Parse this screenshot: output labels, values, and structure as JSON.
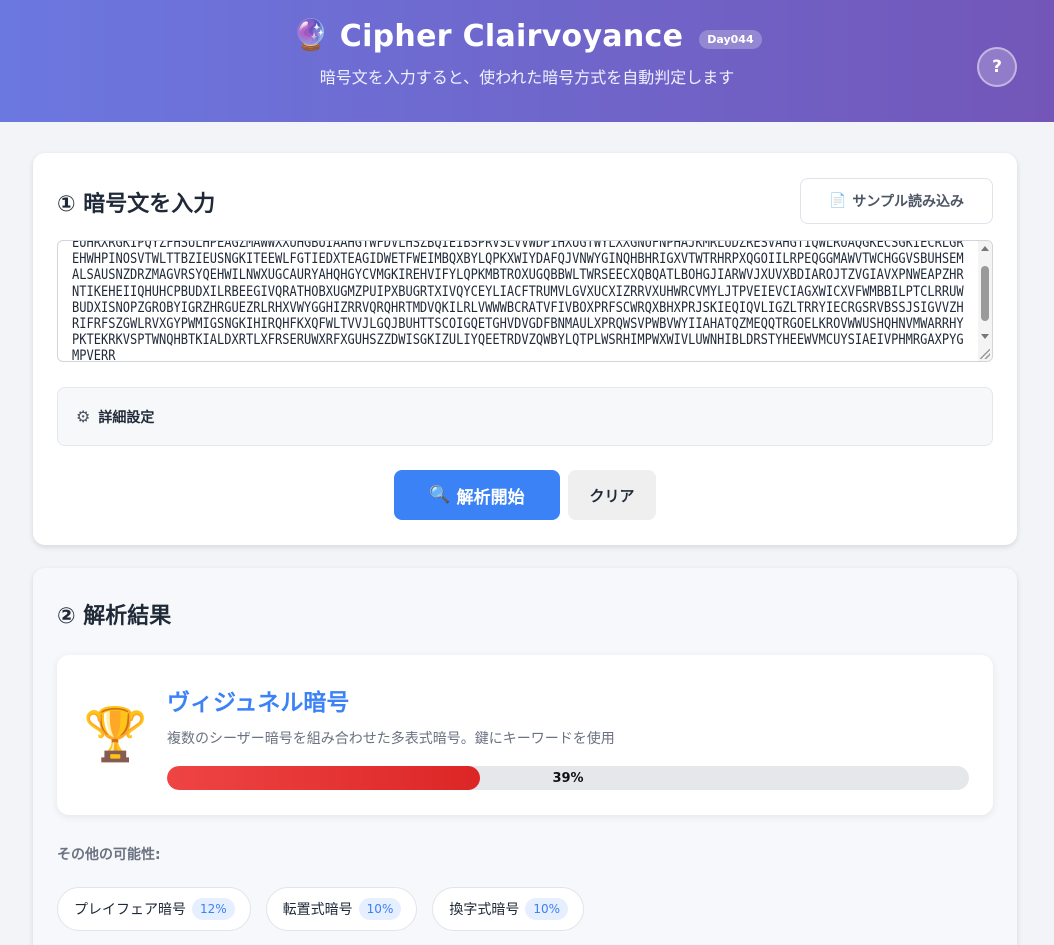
{
  "header": {
    "logo_icon": "crystal-ball",
    "title": "Cipher Clairvoyance",
    "day_badge": "Day044",
    "subtitle": "暗号文を入力すると、使われた暗号方式を自動判定します",
    "help_label": "?"
  },
  "input_section": {
    "title": "① 暗号文を入力",
    "sample_button_label": "サンプル読み込み",
    "cipher_text": "EUHRXRGKIPQYZFHSULHPEAGZMAWWXXUHGBUIAAHGTWFDVLHSZBQIEIBSPRVSLVVWDPIHXUGTWYLXXGNUFNPHAJKMRLUDZRESVAHGTIQWLRUAQGKECSGKIECRLGREHWHPINOSVTWLTTBZIEUSNGKITEEWLFGTIEDXTEAGIDWETFWEIMBQXBYLQPKXWIYDAFQJVNWYGINQHBHRIGXVTWTRHRPXQGOIILRPEQGGMAWVTWCHGGVSBUHSEMALSAUSNZDRZMAGVRSYQEHWILNWXUGCAURYAHQHGYCVMGKIREHVIFYLQPKMBTROXUGQBBWLTWRSEECXQBQATLBOHGJIARWVJXUVXBDIAROJTZVGIAVXPNWEAPZHRNTIKEHEIIQHUHCPBUDXILRBEEGIVQRATHOBXUGMZPUIPXBUGRTXIVQYCEYLIACFTRUMVLGVXUCXIZRRVXUHWRCVMYLJTPVEIEVCIAGXWICXVFWMBBILPTCLRRUWBUDXISNOPZGROBYIGRZHRGUEZRLRHXVWYGGHIZRRVQRQHRTMDVQKILRLVWWWBCRATVFIVBOXPRFSCWRQXBHXPRJSKIEQIQVLIGZLTRRYIECRGSRVBSSJSIGVVZHRIFRFSZGWLRVXGYPWMIGSNGKIHIRQHFKXQFWLTVVJLGQJBUHTTSCOIGQETGHVDVGDFBNMAULXPRQWSVPWBVWYIIAHATQZMEQQTRGOELKROVWWUSHQHNVMWARRHYPKTEKRKVSPTWNQHBTKIALDXRTLXFRSERUWXRFXGUHSZZDWISGKIZULIYQEETRDVZQWBYLQTPLWSRHIMPWXWIVLUWNHIBLDRSTYHEEWVMCUYSIAEIVPHMRGAXPYGMPVERR",
    "advanced_settings_label": "詳細設定",
    "analyze_button_label": "解析開始",
    "clear_button_label": "クリア"
  },
  "results_section": {
    "title": "② 解析結果",
    "top_result": {
      "icon": "trophy",
      "name": "ヴィジュネル暗号",
      "description": "複数のシーザー暗号を組み合わせた多表式暗号。鍵にキーワードを使用",
      "confidence_label": "39%",
      "confidence_value": 0.39,
      "bar_color": "#dc2626"
    },
    "others_title": "その他の可能性:",
    "others": [
      {
        "name": "プレイフェア暗号",
        "score": "12%"
      },
      {
        "name": "転置式暗号",
        "score": "10%"
      },
      {
        "name": "換字式暗号",
        "score": "10%"
      }
    ]
  },
  "colors": {
    "header_gradient_start": "#6b78e0",
    "header_gradient_end": "#7356b8",
    "accent": "#3b82f6"
  }
}
